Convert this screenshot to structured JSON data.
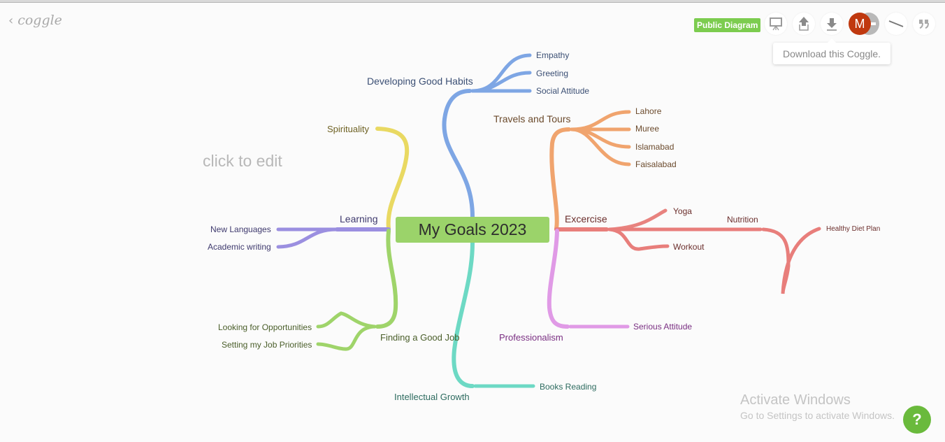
{
  "app": {
    "logo": "coggle",
    "back_icon": "chevron-left-icon",
    "public_badge": "Public Diagram",
    "toolbar": [
      {
        "name": "present-button",
        "icon": "presentation-icon"
      },
      {
        "name": "share-button",
        "icon": "upload-icon"
      },
      {
        "name": "download-button",
        "icon": "download-icon"
      },
      {
        "name": "history-button",
        "icon": "slash-icon"
      },
      {
        "name": "comments-button",
        "icon": "quote-icon"
      }
    ],
    "avatar_initial": "M",
    "tooltip": "Download this Coggle.",
    "hint": "click to edit",
    "help": "?",
    "colors": {
      "brand_green": "#7ccc4f",
      "avatar": "#c0390f"
    }
  },
  "mindmap": {
    "root": "My Goals 2023",
    "branches": [
      {
        "label": "Developing Good Habits",
        "color": "#7ea6e4",
        "children": [
          "Empathy",
          "Greeting",
          "Social Attitude"
        ]
      },
      {
        "label": "Travels and Tours",
        "color": "#f0a46e",
        "children": [
          "Lahore",
          "Muree",
          "Islamabad",
          "Faisalabad"
        ]
      },
      {
        "label": "Spirituality",
        "color": "#e9d962",
        "children": []
      },
      {
        "label": "Learning",
        "color": "#9b8fe0",
        "children": [
          "New Languages",
          "Academic writing"
        ]
      },
      {
        "label": "Excercise",
        "color": "#e87e7b",
        "children": [
          "Yoga",
          "Workout"
        ]
      },
      {
        "label": "Nutrition",
        "color": "#e87e7b",
        "children": [
          "Healthy Diet Plan"
        ]
      },
      {
        "label": "Finding a Good Job",
        "color": "#9fd46a",
        "children": [
          "Looking for Opportunities",
          "Setting my Job Priorities"
        ]
      },
      {
        "label": "Professionalism",
        "color": "#e09ae6",
        "children": [
          "Serious Attitude"
        ]
      },
      {
        "label": "Intellectual Growth",
        "color": "#6dd9c4",
        "children": [
          "Books Reading"
        ]
      }
    ]
  },
  "watermark": {
    "line1": "Activate Windows",
    "line2": "Go to Settings to activate Windows."
  }
}
